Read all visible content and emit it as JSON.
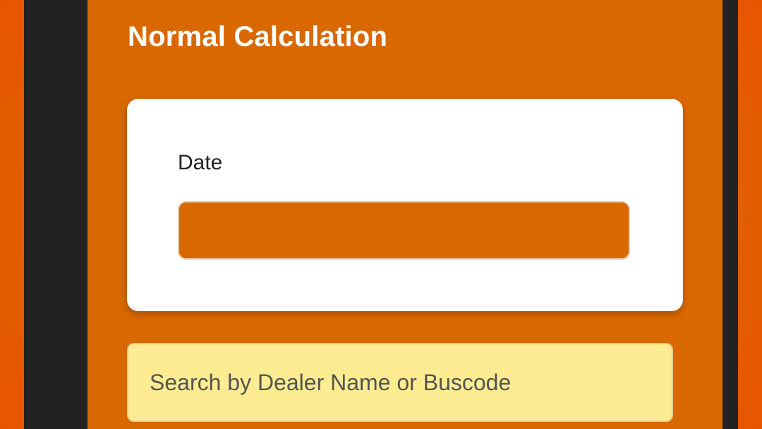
{
  "header": {
    "title": "Normal Calculation"
  },
  "date_card": {
    "label": "Date",
    "value": ""
  },
  "search": {
    "placeholder": "Search by Dealer Name or Buscode",
    "value": ""
  },
  "colors": {
    "screen_background": "#d96800",
    "card_background": "#ffffff",
    "search_background": "#fdec91",
    "frame": "#222222"
  }
}
